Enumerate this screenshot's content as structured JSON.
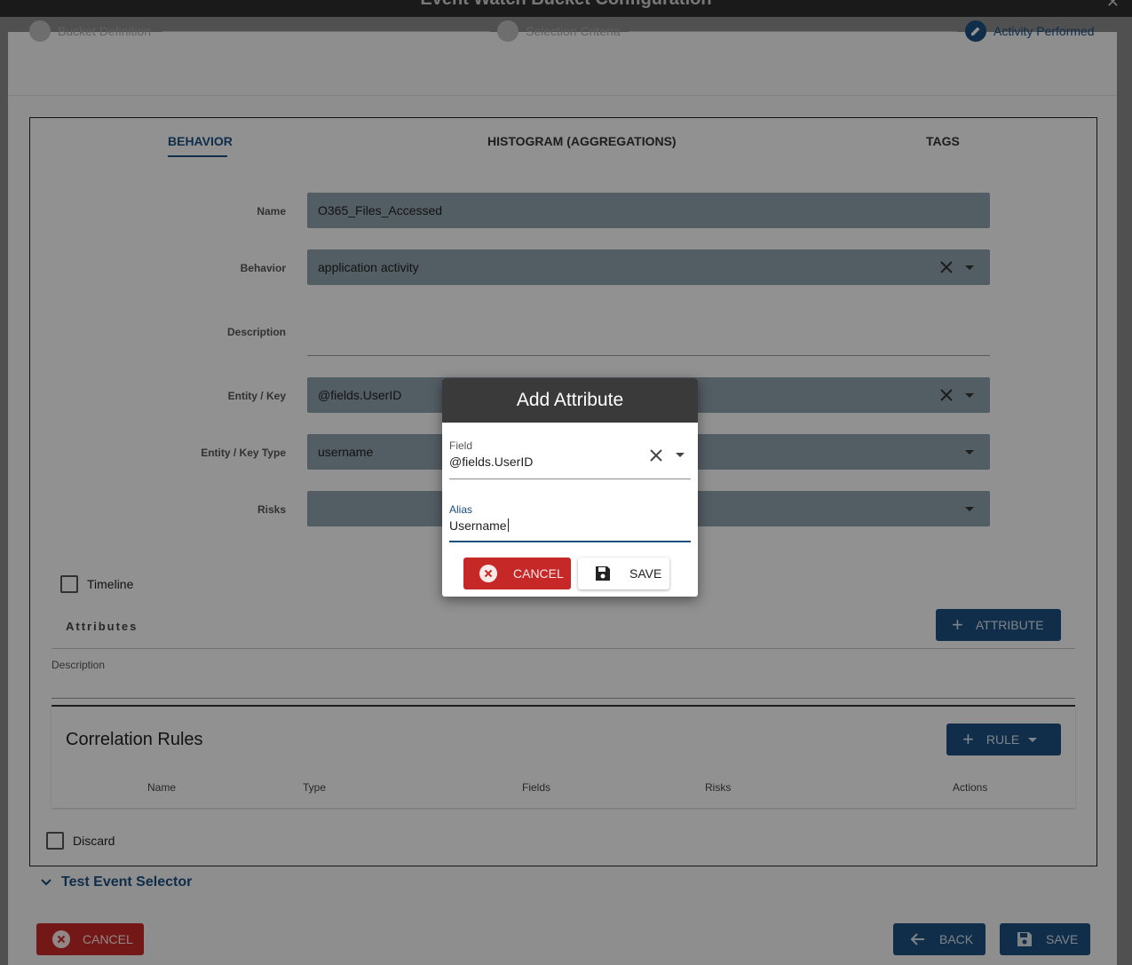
{
  "window": {
    "title": "Event Watch Bucket Configuration"
  },
  "stepper": {
    "steps": [
      {
        "label": "Bucket Definition"
      },
      {
        "label": "Selection Criteria"
      },
      {
        "label": "Activity Performed"
      }
    ]
  },
  "tabs": [
    "BEHAVIOR",
    "HISTOGRAM (AGGREGATIONS)",
    "TAGS"
  ],
  "form": {
    "name_label": "Name",
    "name_value": "O365_Files_Accessed",
    "behavior_label": "Behavior",
    "behavior_value": "application activity",
    "description_label": "Description",
    "entity_key_label": "Entity / Key",
    "entity_key_value": "@fields.UserID",
    "entity_key_type_label": "Entity / Key Type",
    "entity_key_type_value": "username",
    "risks_label": "Risks",
    "risks_value": ""
  },
  "timeline_label": "Timeline",
  "attributes": {
    "title": "Attributes",
    "add_button": "ATTRIBUTE",
    "description_label": "Description"
  },
  "correlation": {
    "title": "Correlation Rules",
    "add_button": "RULE",
    "columns": [
      "Name",
      "Type",
      "Fields",
      "Risks",
      "Actions"
    ]
  },
  "discard_label": "Discard",
  "test_event_selector": "Test Event Selector",
  "footer": {
    "cancel": "CANCEL",
    "back": "BACK",
    "save": "SAVE"
  },
  "dialog": {
    "title": "Add Attribute",
    "field_label": "Field",
    "field_value": "@fields.UserID",
    "alias_label": "Alias",
    "alias_value": "Username",
    "cancel": "CANCEL",
    "save": "SAVE"
  },
  "colors": {
    "primary": "#1c4e80",
    "danger": "#c62828",
    "input_bg": "#8fa0ad"
  }
}
